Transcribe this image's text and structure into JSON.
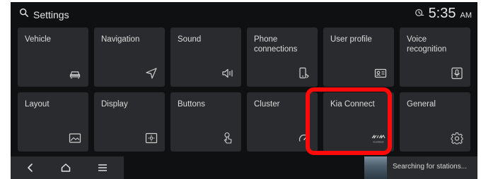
{
  "header": {
    "title": "Settings",
    "time": "5:35",
    "ampm": "AM"
  },
  "tiles": [
    {
      "label": "Vehicle",
      "icon": "car-icon"
    },
    {
      "label": "Navigation",
      "icon": "navigation-arrow-icon"
    },
    {
      "label": "Sound",
      "icon": "speaker-icon"
    },
    {
      "label": "Phone connections",
      "icon": "phone-connection-icon"
    },
    {
      "label": "User profile",
      "icon": "user-profile-icon"
    },
    {
      "label": "Voice recognition",
      "icon": "microphone-icon"
    },
    {
      "label": "Layout",
      "icon": "layout-image-icon"
    },
    {
      "label": "Display",
      "icon": "display-brightness-icon"
    },
    {
      "label": "Buttons",
      "icon": "button-press-icon"
    },
    {
      "label": "Cluster",
      "icon": "gauge-icon"
    },
    {
      "label": "Kia Connect",
      "icon": "kia-connect-logo-icon",
      "logo_text": "Connect"
    },
    {
      "label": "General",
      "icon": "gear-icon"
    }
  ],
  "bottom_bar": {
    "back_icon": "back-chevron-icon",
    "home_icon": "home-icon",
    "menu_icon": "menu-icon",
    "media_text": "Searching for stations..."
  },
  "annotation": {
    "highlight_color": "#ff0a0a",
    "highlight_target": "Kia Connect"
  }
}
